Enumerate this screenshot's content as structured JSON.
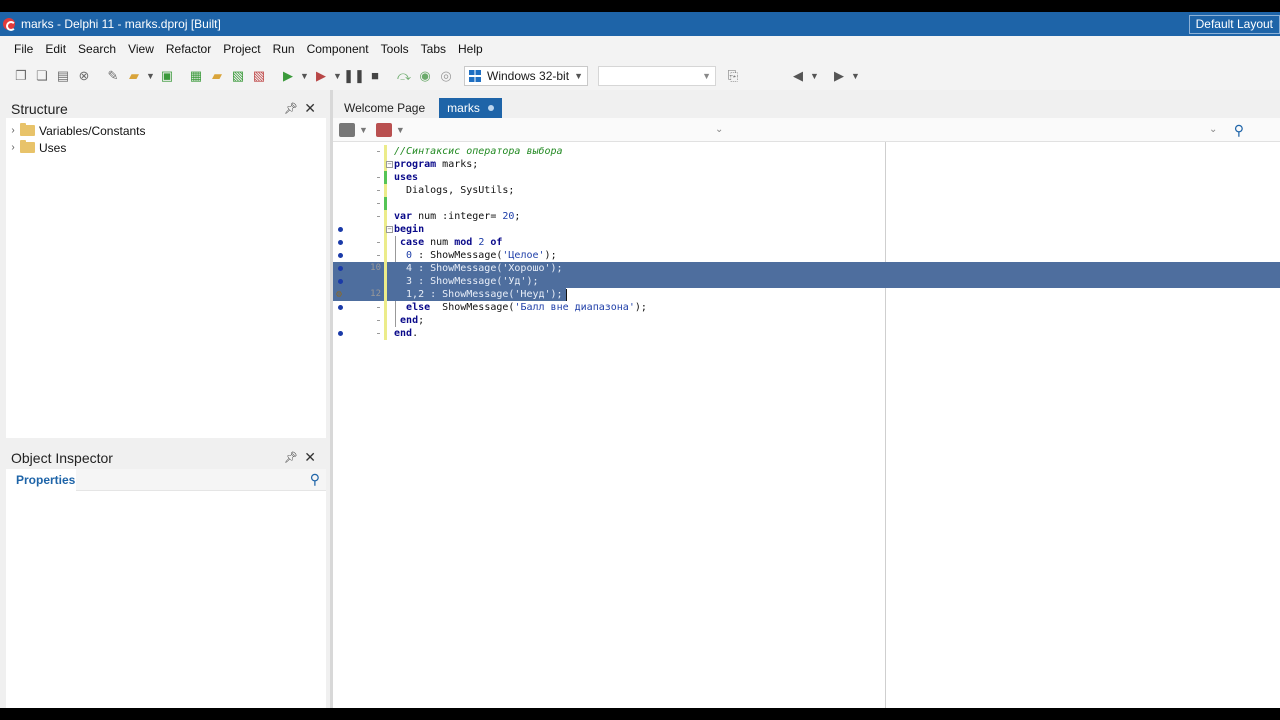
{
  "window": {
    "title": "marks - Delphi 11 - marks.dproj [Built]",
    "layout_button": "Default Layout"
  },
  "menu": [
    "File",
    "Edit",
    "Search",
    "View",
    "Refactor",
    "Project",
    "Run",
    "Component",
    "Tools",
    "Tabs",
    "Help"
  ],
  "toolbar": {
    "platform": "Windows 32-bit",
    "build_config": "",
    "icons": [
      "new-items-icon",
      "open-project-icon",
      "save-all-icon",
      "run-icon",
      "run-without-debug-icon",
      "pause-icon",
      "stop-icon",
      "step-over-icon",
      "back-icon",
      "forward-icon"
    ]
  },
  "structure": {
    "title": "Structure",
    "items": [
      "Variables/Constants",
      "Uses"
    ]
  },
  "object_inspector": {
    "title": "Object Inspector",
    "tab": "Properties",
    "search_placeholder": ""
  },
  "editor": {
    "tabs": [
      {
        "label": "Welcome Page",
        "active": false
      },
      {
        "label": "marks",
        "active": true,
        "modified": true
      }
    ],
    "line_numbers": {
      "10": "10",
      "12": "12"
    },
    "lines": [
      "//Синтаксис оператора выбора",
      "program marks;",
      "uses",
      "  Dialogs, SysUtils;",
      "",
      "var num :integer= 20;",
      "begin",
      " case num mod 2 of",
      "  0 : ShowMessage('Целое');",
      "  4 : ShowMessage('Хорошо');",
      "  3 : ShowMessage('Уд');",
      "  1,2 : ShowMessage('Неуд');",
      "  else  ShowMessage('Балл вне диапазона');",
      " end;",
      "end."
    ],
    "selected_lines": [
      10,
      11,
      12
    ]
  }
}
